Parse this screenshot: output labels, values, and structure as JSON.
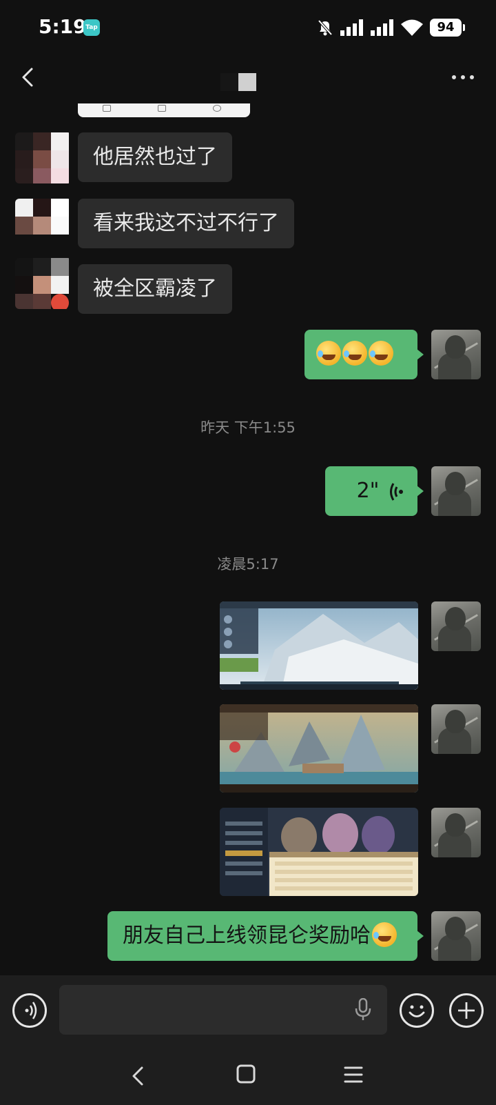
{
  "status_bar": {
    "time": "5:19",
    "app_badge": "Tap",
    "battery": "94",
    "icons": [
      "mute-bell-icon",
      "signal-icon",
      "signal-icon",
      "wifi-icon",
      "battery-icon"
    ]
  },
  "header": {
    "back_icon": "chevron-left-icon",
    "more_icon": "more-dots-icon"
  },
  "messages": [
    {
      "side": "left",
      "type": "text",
      "text": "他居然也过了"
    },
    {
      "side": "left",
      "type": "text",
      "text": "看来我这不过不行了"
    },
    {
      "side": "left",
      "type": "text",
      "text": "被全区霸凌了"
    },
    {
      "side": "right",
      "type": "emoji",
      "emoji": "laughing-crying-emoji",
      "count": 3
    },
    {
      "side": "right",
      "type": "voice",
      "duration": "2\""
    },
    {
      "side": "right",
      "type": "image",
      "description": "game-screenshot-1"
    },
    {
      "side": "right",
      "type": "image",
      "description": "game-screenshot-2"
    },
    {
      "side": "right",
      "type": "image",
      "description": "game-screenshot-3"
    },
    {
      "side": "right",
      "type": "text",
      "text": "朋友自己上线领昆仑奖励哈"
    }
  ],
  "timestamps": {
    "first": "昨天 下午1:55",
    "second": "凌晨5:17"
  },
  "input_bar": {
    "voice_toggle_icon": "voice-mode-icon",
    "input_value": "",
    "mic_icon": "microphone-icon",
    "emoji_icon": "smiley-icon",
    "plus_icon": "plus-circle-icon"
  },
  "system_nav": [
    "back-icon",
    "home-icon",
    "menu-icon"
  ],
  "colors": {
    "background": "#111111",
    "self_bubble": "#58b874",
    "other_bubble": "#2c2c2c",
    "input_bar": "#1e1e1e"
  }
}
